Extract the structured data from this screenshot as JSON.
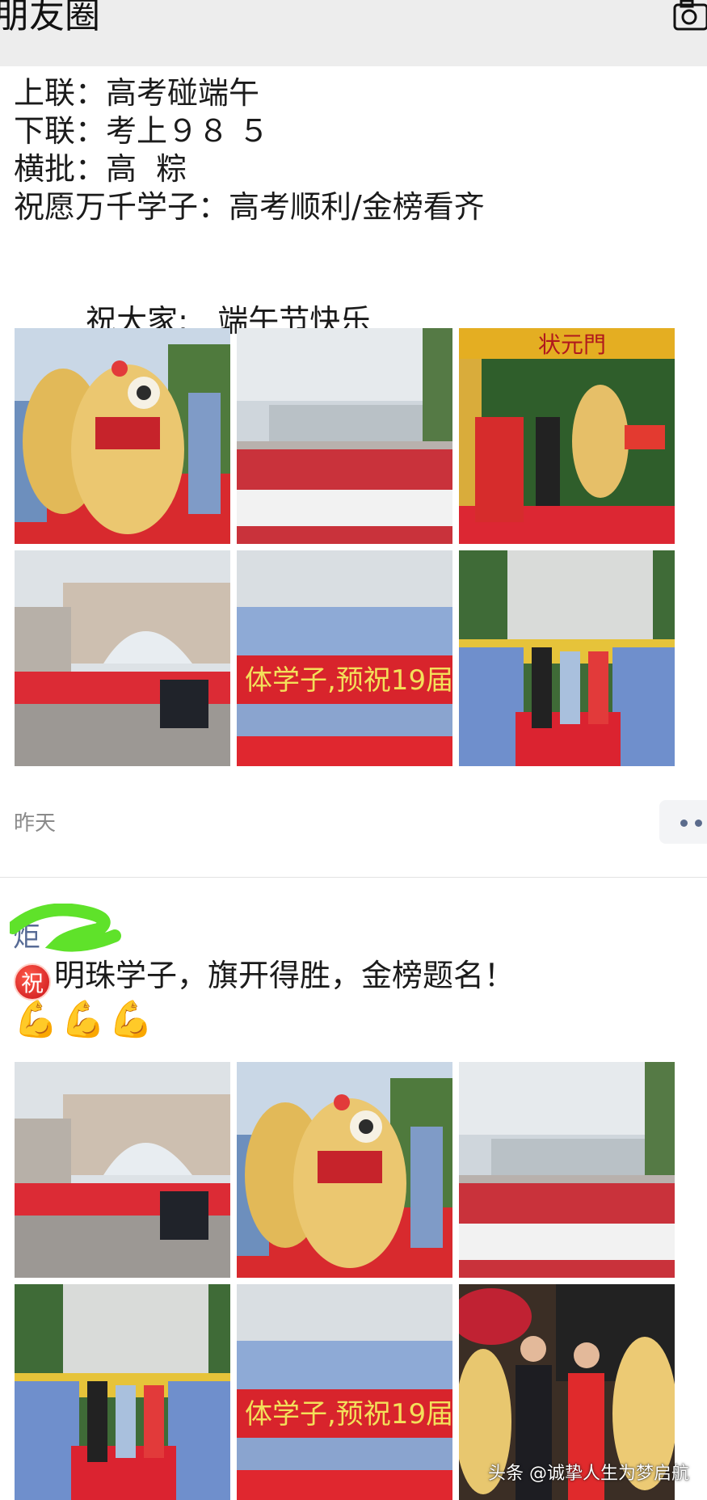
{
  "header": {
    "title": "朋友圈",
    "camera_icon": "camera-icon"
  },
  "post1": {
    "lines": [
      "上联：高考碰端午",
      "下联：考上９８ ５",
      "横批：高  粽",
      "祝愿万千学子：高考顺利/金榜看齐"
    ],
    "greeting": "祝大家:   端午节快乐",
    "greeting_icon": "check-mark-icon",
    "time": "昨天",
    "more_icon": "more-dots-icon"
  },
  "post2": {
    "author": "炬",
    "badge": "祝",
    "text": "明珠学子，旗开得胜，金榜题名！",
    "emojis": [
      "flexed-biceps-icon",
      "flexed-biceps-icon",
      "flexed-biceps-icon"
    ]
  },
  "photos": {
    "banner_text": "体学子，预祝19届",
    "gate_text": "状元門"
  },
  "watermark": "头条 @诚挚人生为梦启航",
  "colors": {
    "header_bg": "#ededed",
    "link_blue": "#576b95",
    "meta_gray": "#8a8a8a",
    "banner_red": "#e0262b",
    "carpet_red": "#d61f2c",
    "lion_gold": "#e8c46c"
  }
}
